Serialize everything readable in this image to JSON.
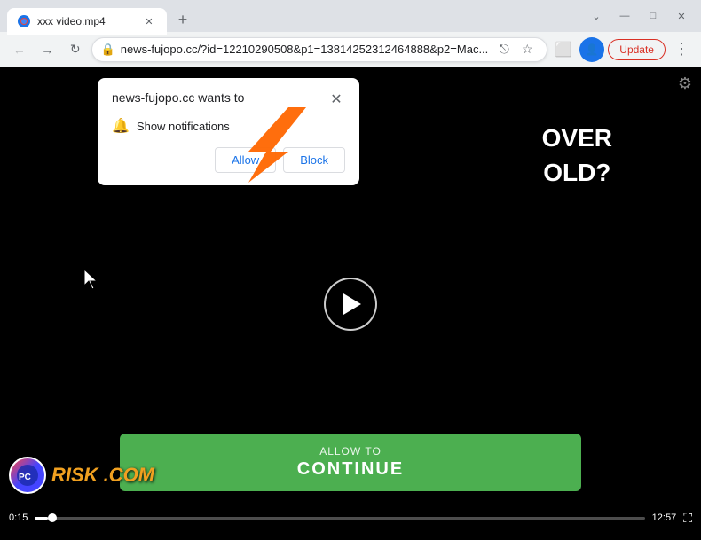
{
  "browser": {
    "tab": {
      "title": "xxx video.mp4",
      "favicon_label": "video-favicon"
    },
    "window_controls": {
      "minimize": "—",
      "maximize": "□",
      "close": "✕",
      "chevron_down": "⌄",
      "chevron_up": "⌃"
    },
    "address_bar": {
      "url": "news-fujopo.cc/?id=12210290508&p1=13814252312464888&p2=Mac...",
      "lock_icon": "🔒",
      "update_label": "Update"
    },
    "nav": {
      "back": "←",
      "forward": "→",
      "reload": "↻"
    }
  },
  "popup": {
    "title": "news-fujopo.cc wants to",
    "close_label": "✕",
    "notification_text": "Show notifications",
    "allow_label": "Allow",
    "block_label": "Block"
  },
  "video": {
    "overlay_text_line1": "OVER",
    "overlay_text_line2": "OLD?",
    "allow_to": "ALLOW TO",
    "continue": "CONTINUE",
    "time_current": "0:15",
    "time_total": "12:57"
  },
  "watermark": {
    "text": "RISK.COM",
    "prefix": "PC"
  },
  "icons": {
    "settings": "⚙",
    "bell": "🔔",
    "play": "▶",
    "fullscreen": "⛶",
    "share": "⎋",
    "bookmark": "☆",
    "extensions": "🧩",
    "menu": "⋮"
  }
}
